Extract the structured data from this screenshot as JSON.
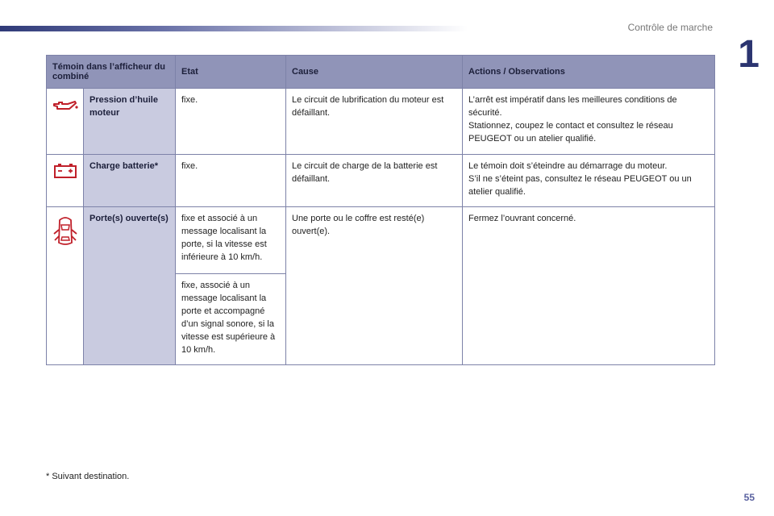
{
  "header": {
    "section_title": "Contrôle de marche",
    "chapter_number": "1"
  },
  "table": {
    "headers": [
      "Témoin dans l’afficheur du combiné",
      "Etat",
      "Cause",
      "Actions / Observations"
    ],
    "rows": [
      {
        "icon": "oil-can-icon",
        "name": "Pression d’huile moteur",
        "etat": "fixe.",
        "cause": "Le circuit de lubrification du moteur est défaillant.",
        "actions": [
          "L’arrêt est impératif dans les meilleures conditions de sécurité.",
          "Stationnez, coupez le contact et consultez le réseau PEUGEOT ou un atelier qualifié."
        ]
      },
      {
        "icon": "battery-icon",
        "name": "Charge batterie*",
        "etat": "fixe.",
        "cause": "Le circuit de charge de la batterie est défaillant.",
        "actions": [
          "Le témoin doit s’éteindre au démarrage du moteur.",
          "S’il ne s’éteint pas, consultez le réseau PEUGEOT ou un atelier qualifié."
        ]
      },
      {
        "icon": "car-door-open-icon",
        "name": "Porte(s) ouverte(s)",
        "etat": "fixe et associé à un message localisant la porte, si la vitesse est inférieure à 10 km/h.",
        "etat2": "fixe, associé à un message localisant la porte et accompagné d’un signal sonore, si la vitesse est supérieure à 10 km/h.",
        "cause": "Une porte ou le coffre est resté(e) ouvert(e).",
        "actions": [
          "Fermez l’ouvrant concerné."
        ]
      }
    ]
  },
  "footnote": "* Suivant destination.",
  "page_number": "55"
}
